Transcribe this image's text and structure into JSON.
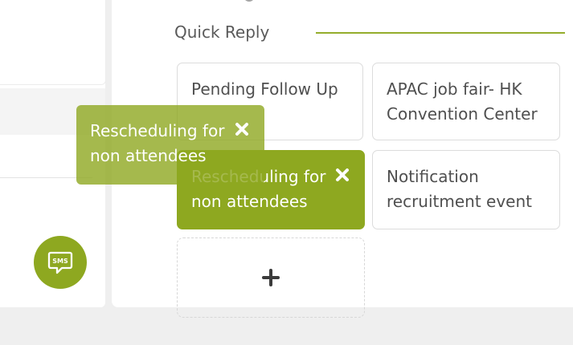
{
  "quick_reply": {
    "title": "Quick Reply",
    "cards": [
      {
        "text": "Pending Follow Up"
      },
      {
        "text": "APAC job fair- HK Convention Center"
      },
      {
        "text": "Rescheduling for non attendees"
      },
      {
        "text": "Notification recruitment event"
      }
    ],
    "add_label": "+"
  },
  "drag_ghost": {
    "text": "Rescheduling for non attendees"
  },
  "sms_button": {
    "label": "SMS"
  },
  "colors": {
    "accent": "#8ea820",
    "accent_line": "#94ad2b",
    "text": "#4f4f4f",
    "border": "#dcdcdc",
    "background": "#efefef"
  }
}
